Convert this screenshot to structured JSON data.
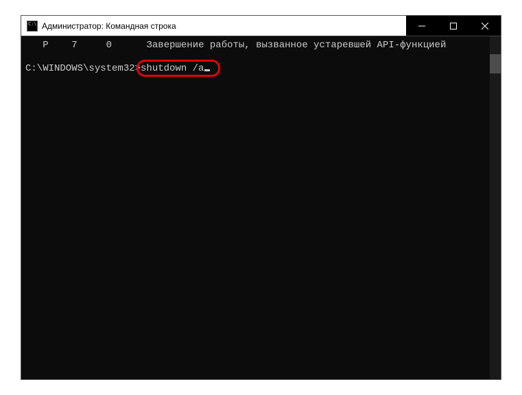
{
  "window": {
    "icon_text": "C:\\",
    "title": "Администратор: Командная строка"
  },
  "output": {
    "col1": "P",
    "col2": "7",
    "col3": "0",
    "message": "Завершение работы, вызванное устаревшей API-функцией"
  },
  "prompt": {
    "path": "C:\\WINDOWS\\system32>",
    "command": "shutdown /a"
  }
}
